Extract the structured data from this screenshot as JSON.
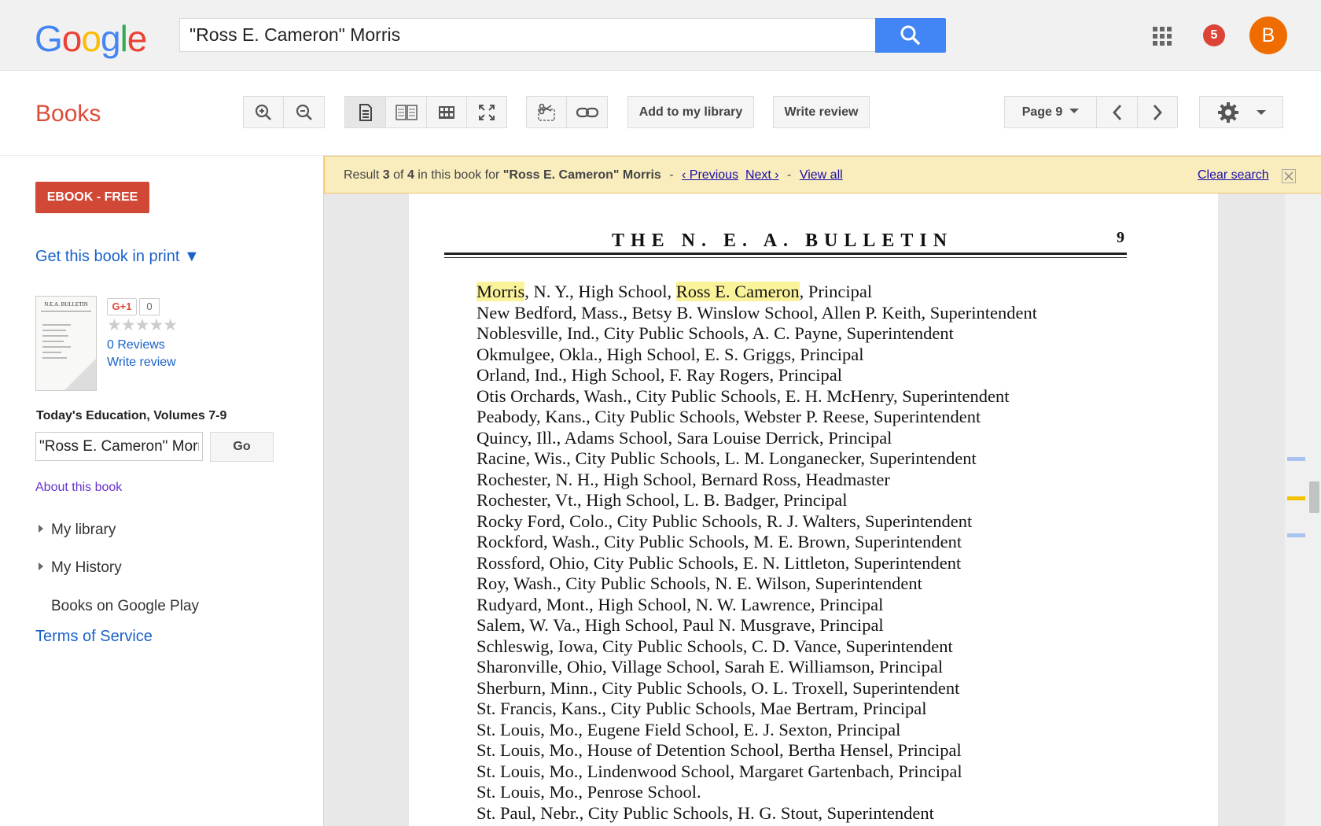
{
  "header": {
    "logo_letters": [
      "G",
      "o",
      "o",
      "g",
      "l",
      "e"
    ],
    "logo_colors": [
      "#4285f4",
      "#ea4335",
      "#fbbc05",
      "#4285f4",
      "#34a853",
      "#ea4335"
    ],
    "search_query": "\"Ross E. Cameron\" Morris",
    "notification_count": "5",
    "avatar_letter": "B"
  },
  "toolbar": {
    "books_title": "Books",
    "add_library": "Add to my library",
    "write_review": "Write review",
    "page_label": "Page 9"
  },
  "sidebar": {
    "ebook_button": "EBOOK - FREE",
    "get_print": "Get this book in print ▼",
    "gplus": "G+1",
    "gplus_count": "0",
    "stars": "★★★★★",
    "reviews": "0 Reviews",
    "write_review": "Write review",
    "book_name": "Today's Education, Volumes 7-9",
    "inbook_query": "\"Ross E. Cameron\" Morris",
    "go": "Go",
    "about": "About this book",
    "my_library": "My library",
    "my_history": "My History",
    "play": "Books on Google Play",
    "tos": "Terms of Service",
    "thumb_title": "N.E.A. BULLETIN"
  },
  "result_bar": {
    "prefix": "Result ",
    "result_num": "3",
    "of": " of ",
    "total": "4",
    "mid": " in this book for ",
    "query": "\"Ross E. Cameron\" Morris",
    "sep1": " - ",
    "previous": "‹ Previous",
    "next": "Next ›",
    "sep2": " - ",
    "view_all": "View all",
    "clear": "Clear search"
  },
  "page": {
    "header": "THE N. E. A. BULLETIN",
    "number": "9",
    "first_line": {
      "hl1": "Morris",
      "mid": ", N. Y., High School, ",
      "hl2": "Ross E. Cameron",
      "tail": ", Principal"
    },
    "lines": [
      "New Bedford, Mass., Betsy B. Winslow School, Allen P. Keith, Superintendent",
      "Noblesville, Ind., City Public Schools, A. C. Payne, Superintendent",
      "Okmulgee, Okla., High School, E. S. Griggs, Principal",
      "Orland, Ind., High School, F. Ray Rogers, Principal",
      "Otis Orchards, Wash., City Public Schools, E. H. McHenry, Superintendent",
      "Peabody, Kans., City Public Schools, Webster P. Reese, Superintendent",
      "Quincy, Ill., Adams School, Sara Louise Derrick, Principal",
      "Racine, Wis., City Public Schools, L. M. Longanecker, Superintendent",
      "Rochester, N. H., High School, Bernard Ross, Headmaster",
      "Rochester, Vt., High School, L. B. Badger, Principal",
      "Rocky Ford, Colo., City Public Schools, R. J. Walters, Superintendent",
      "Rockford, Wash., City Public Schools, M. E. Brown, Superintendent",
      "Rossford, Ohio, City Public Schools, E. N. Littleton, Superintendent",
      "Roy, Wash., City Public Schools, N. E. Wilson, Superintendent",
      "Rudyard, Mont., High School, N. W. Lawrence, Principal",
      "Salem, W. Va., High School, Paul N. Musgrave, Principal",
      "Schleswig, Iowa, City Public Schools, C. D. Vance, Superintendent",
      "Sharonville, Ohio, Village School, Sarah E. Williamson, Principal",
      "Sherburn, Minn., City Public Schools, O. L. Troxell, Superintendent",
      "St. Francis, Kans., City Public Schools, Mae Bertram, Principal",
      "St. Louis, Mo., Eugene Field School, E. J. Sexton, Principal",
      "St. Louis, Mo., House of Detention School, Bertha Hensel, Principal",
      "St. Louis, Mo., Lindenwood School, Margaret Gartenbach, Principal",
      "St. Louis, Mo., Penrose School.",
      "St. Paul, Nebr., City Public Schools, H. G. Stout, Superintendent"
    ]
  }
}
